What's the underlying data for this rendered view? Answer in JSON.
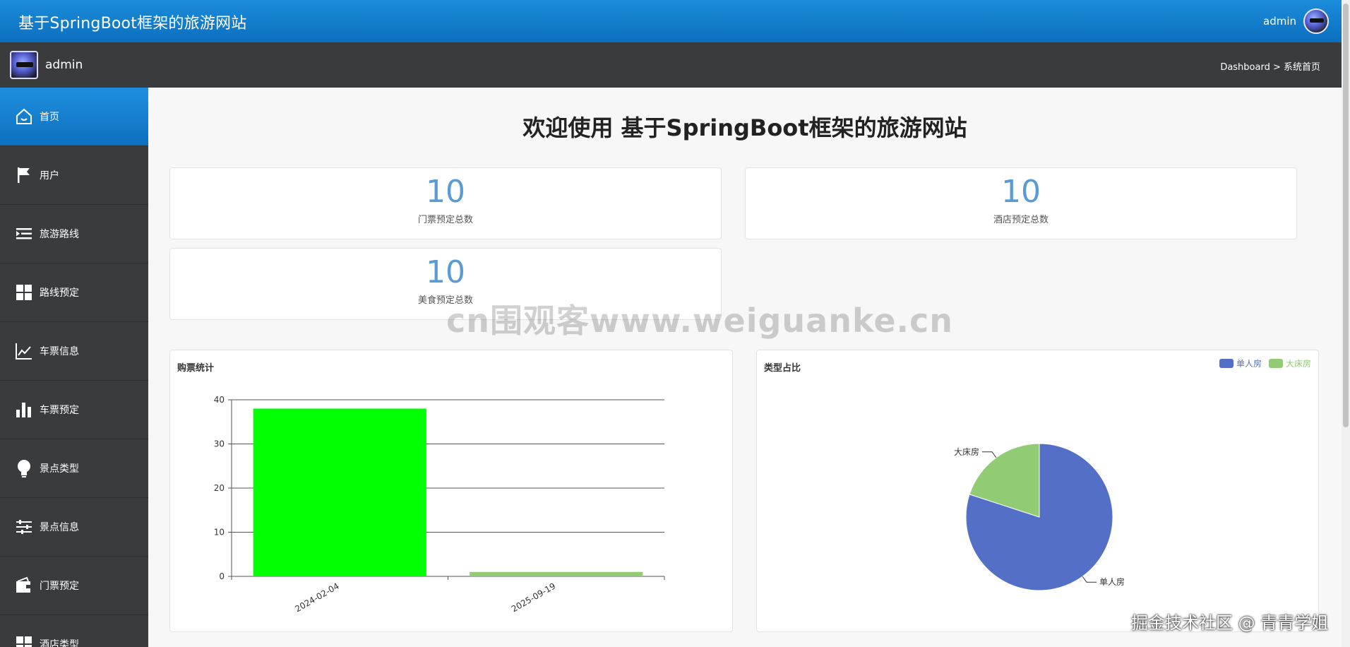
{
  "header": {
    "title": "基于SpringBoot框架的旅游网站",
    "username": "admin"
  },
  "subheader": {
    "username": "admin",
    "breadcrumb": "Dashboard > 系统首页"
  },
  "sidebar": {
    "items": [
      {
        "label": "首页",
        "icon": "home-icon"
      },
      {
        "label": "用户",
        "icon": "flag-icon"
      },
      {
        "label": "旅游路线",
        "icon": "indent-icon"
      },
      {
        "label": "路线预定",
        "icon": "grid-icon"
      },
      {
        "label": "车票信息",
        "icon": "trend-icon"
      },
      {
        "label": "车票预定",
        "icon": "bar-chart-icon"
      },
      {
        "label": "景点类型",
        "icon": "bulb-icon"
      },
      {
        "label": "景点信息",
        "icon": "sliders-icon"
      },
      {
        "label": "门票预定",
        "icon": "wallet-icon"
      },
      {
        "label": "酒店类型",
        "icon": "grid-icon"
      }
    ]
  },
  "main": {
    "welcome": "欢迎使用 基于SpringBoot框架的旅游网站",
    "stats": [
      {
        "value": "10",
        "label": "门票预定总数"
      },
      {
        "value": "10",
        "label": "酒店预定总数"
      },
      {
        "value": "10",
        "label": "美食预定总数"
      }
    ]
  },
  "chart_data": [
    {
      "type": "bar",
      "title": "购票统计",
      "categories": [
        "2024-02-04",
        "2025-09-19"
      ],
      "values": [
        38,
        1
      ],
      "colors": [
        "#00ff00",
        "#91cc75"
      ],
      "ylim": [
        0,
        40
      ],
      "yticks": [
        0,
        10,
        20,
        30,
        40
      ],
      "grid": true
    },
    {
      "type": "pie",
      "title": "类型占比",
      "slices": [
        {
          "name": "单人房",
          "value": 8,
          "color": "#5470c6"
        },
        {
          "name": "大床房",
          "value": 2,
          "color": "#91cc75"
        }
      ],
      "legend": "top-right"
    }
  ],
  "watermark": "cn围观客www.weiguanke.cn",
  "corner_mark": "掘金技术社区 @ 青青学姐"
}
